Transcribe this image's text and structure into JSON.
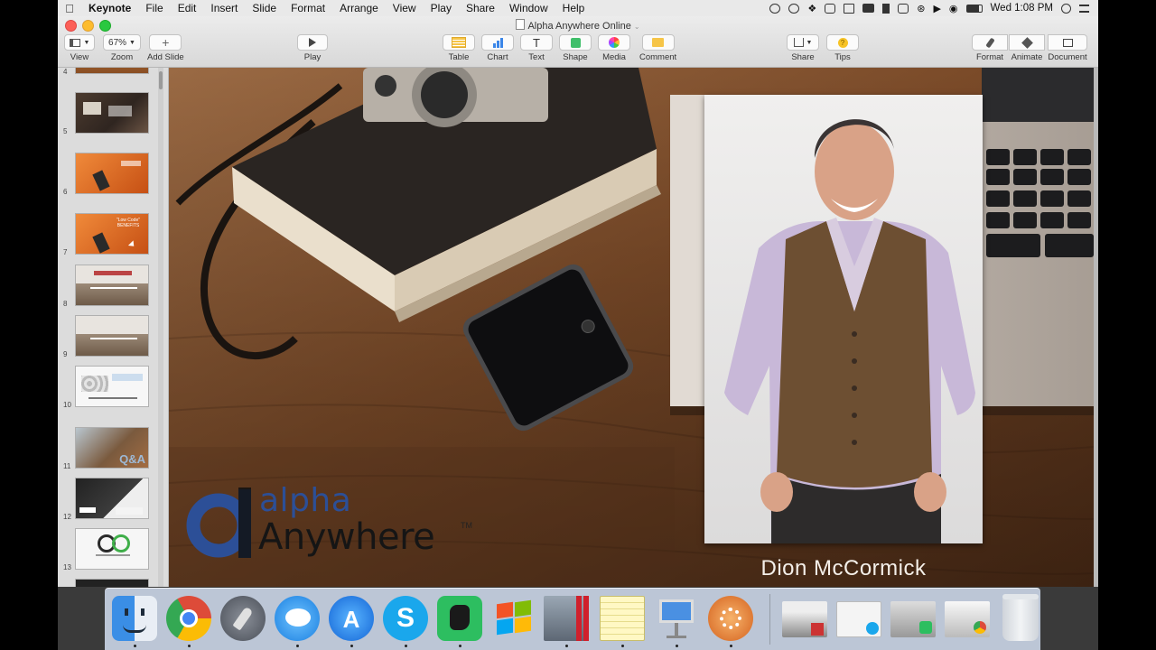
{
  "menubar": {
    "app": "Keynote",
    "items": [
      "File",
      "Edit",
      "Insert",
      "Slide",
      "Format",
      "Arrange",
      "View",
      "Play",
      "Share",
      "Window",
      "Help"
    ],
    "clock": "Wed 1:08 PM"
  },
  "window": {
    "title": "Alpha Anywhere Online"
  },
  "toolbar": {
    "view_label": "View",
    "zoom_value": "67%",
    "zoom_label": "Zoom",
    "add_slide_label": "Add Slide",
    "play_label": "Play",
    "table_label": "Table",
    "chart_label": "Chart",
    "text_label": "Text",
    "shape_label": "Shape",
    "media_label": "Media",
    "comment_label": "Comment",
    "share_label": "Share",
    "tips_label": "Tips",
    "format_label": "Format",
    "animate_label": "Animate",
    "document_label": "Document"
  },
  "navigator": {
    "slides": [
      {
        "num": "4",
        "style": "desk-orange"
      },
      {
        "num": "5",
        "style": "desk-dark"
      },
      {
        "num": "6",
        "style": "orange"
      },
      {
        "num": "7",
        "style": "orange"
      },
      {
        "num": "8",
        "style": "desk-grey"
      },
      {
        "num": "9",
        "style": "desk-grey"
      },
      {
        "num": "10",
        "style": "white"
      },
      {
        "num": "11",
        "style": "desk-qa"
      },
      {
        "num": "12",
        "style": "dark"
      },
      {
        "num": "13",
        "style": "white-logo"
      }
    ],
    "slide7_title": "\"Low Code\" BENEFITS",
    "slide11_text": "Q&A"
  },
  "slide": {
    "logo_top": "alpha",
    "logo_bottom": "Anywhere",
    "logo_tm": "TM",
    "person_name": "Dion McCormick"
  },
  "dock": {
    "apps": [
      "finder-icon",
      "chrome-icon",
      "launchpad-icon",
      "messages-icon",
      "app-store-icon",
      "skype-icon",
      "evernote-icon",
      "windows-icon",
      "parallels-icon",
      "notes-icon",
      "keynote-icon",
      "camtasia-icon"
    ],
    "minimized_windows": 4
  },
  "colors": {
    "accent": "#4a90e2",
    "logo_blue": "#2c4f97",
    "slide_orange": "#d9661f"
  }
}
